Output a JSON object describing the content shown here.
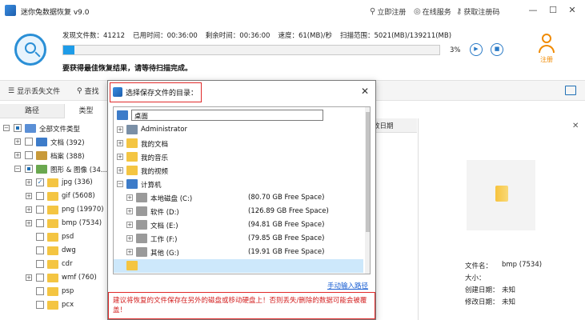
{
  "app": {
    "title": "迷你兔数据恢复 v9.0"
  },
  "titlebar": {
    "register_link": "立即注册",
    "service_link": "在线服务",
    "code_link": "获取注册码",
    "minimize": "—",
    "restore": "☐",
    "close": "✕"
  },
  "scan": {
    "found_files_label": "发现文件数：",
    "found_files": "41212",
    "elapsed_label": "已用时间：",
    "elapsed": "00:36:00",
    "remaining_label": "剩余时间：",
    "remaining": "00:36:00",
    "speed_label": "速度：",
    "speed": "61(MB)/秒",
    "range_label": "扫描范围：",
    "range": "5021(MB)/139211(MB)",
    "percent_text": "3%",
    "progress": 0.03,
    "message": "要获得最佳恢复结果，请等待扫描完成。",
    "play": "▶",
    "stop": "■"
  },
  "register": {
    "label": "注册"
  },
  "toolbar": {
    "show_lost": "显示丢失文件",
    "search": "查找"
  },
  "left_panel": {
    "tabs": [
      "路径",
      "类型"
    ],
    "tree": [
      {
        "label": "全部文件类型",
        "indent": 0,
        "exp": "−",
        "state": "partial",
        "icon": "#5a8fd6"
      },
      {
        "label": "文档 (392)",
        "indent": 1,
        "exp": "+",
        "state": "none",
        "icon": "#3d7cc9"
      },
      {
        "label": "档案 (388)",
        "indent": 1,
        "exp": "+",
        "state": "none",
        "icon": "#c89a3a"
      },
      {
        "label": "图形 & 图像 (34...",
        "indent": 1,
        "exp": "−",
        "state": "partial",
        "icon": "#6aa84f"
      },
      {
        "label": "jpg (336)",
        "indent": 2,
        "exp": "+",
        "state": "checked",
        "icon": "#f4c542"
      },
      {
        "label": "gif (5608)",
        "indent": 2,
        "exp": "+",
        "state": "none",
        "icon": "#f4c542"
      },
      {
        "label": "png (19970)",
        "indent": 2,
        "exp": "+",
        "state": "none",
        "icon": "#f4c542"
      },
      {
        "label": "bmp (7534)",
        "indent": 2,
        "exp": "+",
        "state": "none",
        "icon": "#f4c542"
      },
      {
        "label": "psd",
        "indent": 2,
        "exp": "",
        "state": "none",
        "icon": "#f4c542"
      },
      {
        "label": "dwg",
        "indent": 2,
        "exp": "",
        "state": "none",
        "icon": "#f4c542"
      },
      {
        "label": "cdr",
        "indent": 2,
        "exp": "",
        "state": "none",
        "icon": "#f4c542"
      },
      {
        "label": "wmf (760)",
        "indent": 2,
        "exp": "+",
        "state": "none",
        "icon": "#f4c542"
      },
      {
        "label": "psp",
        "indent": 2,
        "exp": "",
        "state": "none",
        "icon": "#f4c542"
      },
      {
        "label": "pcx",
        "indent": 2,
        "exp": "",
        "state": "none",
        "icon": "#f4c542"
      }
    ]
  },
  "file_list": {
    "col_date": "改日期"
  },
  "preview": {
    "close": "✕",
    "props": [
      {
        "key": "文件名：",
        "value": "bmp (7534)"
      },
      {
        "key": "大小：",
        "value": ""
      },
      {
        "key": "创建日期：",
        "value": "未知"
      },
      {
        "key": "修改日期：",
        "value": "未知"
      }
    ]
  },
  "dialog": {
    "title": "选择保存文件的目录：",
    "close": "✕",
    "desktop": "桌面",
    "nodes": [
      {
        "label": "Administrator",
        "indent": 1,
        "exp": "+",
        "icon": "user",
        "space": ""
      },
      {
        "label": "我的文档",
        "indent": 1,
        "exp": "+",
        "icon": "folder",
        "space": ""
      },
      {
        "label": "我的音乐",
        "indent": 1,
        "exp": "+",
        "icon": "folder",
        "space": ""
      },
      {
        "label": "我的视频",
        "indent": 1,
        "exp": "+",
        "icon": "folder",
        "space": ""
      },
      {
        "label": "计算机",
        "indent": 1,
        "exp": "−",
        "icon": "pc",
        "space": ""
      },
      {
        "label": "本地磁盘 (C:)",
        "indent": 2,
        "exp": "+",
        "icon": "drive",
        "space": "(80.70 GB Free Space)"
      },
      {
        "label": "软件 (D:)",
        "indent": 2,
        "exp": "+",
        "icon": "drive",
        "space": "(126.89 GB Free Space)"
      },
      {
        "label": "文档 (E:)",
        "indent": 2,
        "exp": "+",
        "icon": "drive",
        "space": "(94.81 GB Free Space)"
      },
      {
        "label": "工作 (F:)",
        "indent": 2,
        "exp": "+",
        "icon": "drive",
        "space": "(79.85 GB Free Space)"
      },
      {
        "label": "其他 (G:)",
        "indent": 2,
        "exp": "+",
        "icon": "drive",
        "space": "(19.91 GB Free Space)"
      },
      {
        "label": "",
        "indent": 1,
        "exp": "",
        "icon": "folder",
        "space": "",
        "selected": true
      },
      {
        "label": "",
        "indent": 1,
        "exp": "+",
        "icon": "folder",
        "space": ""
      }
    ],
    "manual_link": "手动输入路径",
    "warning": "建议将恢复的文件保存在另外的磁盘或移动硬盘上！否则丢失/删除的数据可能会被覆盖！"
  },
  "colors": {
    "accent": "#1e9ce8",
    "register": "#f08a00",
    "warning": "#d31f1f",
    "link": "#1a5fd3"
  }
}
